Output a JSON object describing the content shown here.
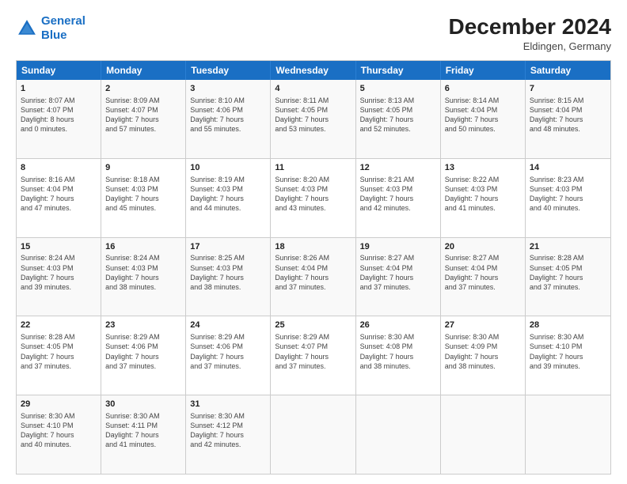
{
  "logo": {
    "line1": "General",
    "line2": "Blue"
  },
  "title": "December 2024",
  "location": "Eldingen, Germany",
  "days_of_week": [
    "Sunday",
    "Monday",
    "Tuesday",
    "Wednesday",
    "Thursday",
    "Friday",
    "Saturday"
  ],
  "weeks": [
    [
      {
        "day": "1",
        "lines": [
          "Sunrise: 8:07 AM",
          "Sunset: 4:07 PM",
          "Daylight: 8 hours",
          "and 0 minutes."
        ]
      },
      {
        "day": "2",
        "lines": [
          "Sunrise: 8:09 AM",
          "Sunset: 4:07 PM",
          "Daylight: 7 hours",
          "and 57 minutes."
        ]
      },
      {
        "day": "3",
        "lines": [
          "Sunrise: 8:10 AM",
          "Sunset: 4:06 PM",
          "Daylight: 7 hours",
          "and 55 minutes."
        ]
      },
      {
        "day": "4",
        "lines": [
          "Sunrise: 8:11 AM",
          "Sunset: 4:05 PM",
          "Daylight: 7 hours",
          "and 53 minutes."
        ]
      },
      {
        "day": "5",
        "lines": [
          "Sunrise: 8:13 AM",
          "Sunset: 4:05 PM",
          "Daylight: 7 hours",
          "and 52 minutes."
        ]
      },
      {
        "day": "6",
        "lines": [
          "Sunrise: 8:14 AM",
          "Sunset: 4:04 PM",
          "Daylight: 7 hours",
          "and 50 minutes."
        ]
      },
      {
        "day": "7",
        "lines": [
          "Sunrise: 8:15 AM",
          "Sunset: 4:04 PM",
          "Daylight: 7 hours",
          "and 48 minutes."
        ]
      }
    ],
    [
      {
        "day": "8",
        "lines": [
          "Sunrise: 8:16 AM",
          "Sunset: 4:04 PM",
          "Daylight: 7 hours",
          "and 47 minutes."
        ]
      },
      {
        "day": "9",
        "lines": [
          "Sunrise: 8:18 AM",
          "Sunset: 4:03 PM",
          "Daylight: 7 hours",
          "and 45 minutes."
        ]
      },
      {
        "day": "10",
        "lines": [
          "Sunrise: 8:19 AM",
          "Sunset: 4:03 PM",
          "Daylight: 7 hours",
          "and 44 minutes."
        ]
      },
      {
        "day": "11",
        "lines": [
          "Sunrise: 8:20 AM",
          "Sunset: 4:03 PM",
          "Daylight: 7 hours",
          "and 43 minutes."
        ]
      },
      {
        "day": "12",
        "lines": [
          "Sunrise: 8:21 AM",
          "Sunset: 4:03 PM",
          "Daylight: 7 hours",
          "and 42 minutes."
        ]
      },
      {
        "day": "13",
        "lines": [
          "Sunrise: 8:22 AM",
          "Sunset: 4:03 PM",
          "Daylight: 7 hours",
          "and 41 minutes."
        ]
      },
      {
        "day": "14",
        "lines": [
          "Sunrise: 8:23 AM",
          "Sunset: 4:03 PM",
          "Daylight: 7 hours",
          "and 40 minutes."
        ]
      }
    ],
    [
      {
        "day": "15",
        "lines": [
          "Sunrise: 8:24 AM",
          "Sunset: 4:03 PM",
          "Daylight: 7 hours",
          "and 39 minutes."
        ]
      },
      {
        "day": "16",
        "lines": [
          "Sunrise: 8:24 AM",
          "Sunset: 4:03 PM",
          "Daylight: 7 hours",
          "and 38 minutes."
        ]
      },
      {
        "day": "17",
        "lines": [
          "Sunrise: 8:25 AM",
          "Sunset: 4:03 PM",
          "Daylight: 7 hours",
          "and 38 minutes."
        ]
      },
      {
        "day": "18",
        "lines": [
          "Sunrise: 8:26 AM",
          "Sunset: 4:04 PM",
          "Daylight: 7 hours",
          "and 37 minutes."
        ]
      },
      {
        "day": "19",
        "lines": [
          "Sunrise: 8:27 AM",
          "Sunset: 4:04 PM",
          "Daylight: 7 hours",
          "and 37 minutes."
        ]
      },
      {
        "day": "20",
        "lines": [
          "Sunrise: 8:27 AM",
          "Sunset: 4:04 PM",
          "Daylight: 7 hours",
          "and 37 minutes."
        ]
      },
      {
        "day": "21",
        "lines": [
          "Sunrise: 8:28 AM",
          "Sunset: 4:05 PM",
          "Daylight: 7 hours",
          "and 37 minutes."
        ]
      }
    ],
    [
      {
        "day": "22",
        "lines": [
          "Sunrise: 8:28 AM",
          "Sunset: 4:05 PM",
          "Daylight: 7 hours",
          "and 37 minutes."
        ]
      },
      {
        "day": "23",
        "lines": [
          "Sunrise: 8:29 AM",
          "Sunset: 4:06 PM",
          "Daylight: 7 hours",
          "and 37 minutes."
        ]
      },
      {
        "day": "24",
        "lines": [
          "Sunrise: 8:29 AM",
          "Sunset: 4:06 PM",
          "Daylight: 7 hours",
          "and 37 minutes."
        ]
      },
      {
        "day": "25",
        "lines": [
          "Sunrise: 8:29 AM",
          "Sunset: 4:07 PM",
          "Daylight: 7 hours",
          "and 37 minutes."
        ]
      },
      {
        "day": "26",
        "lines": [
          "Sunrise: 8:30 AM",
          "Sunset: 4:08 PM",
          "Daylight: 7 hours",
          "and 38 minutes."
        ]
      },
      {
        "day": "27",
        "lines": [
          "Sunrise: 8:30 AM",
          "Sunset: 4:09 PM",
          "Daylight: 7 hours",
          "and 38 minutes."
        ]
      },
      {
        "day": "28",
        "lines": [
          "Sunrise: 8:30 AM",
          "Sunset: 4:10 PM",
          "Daylight: 7 hours",
          "and 39 minutes."
        ]
      }
    ],
    [
      {
        "day": "29",
        "lines": [
          "Sunrise: 8:30 AM",
          "Sunset: 4:10 PM",
          "Daylight: 7 hours",
          "and 40 minutes."
        ]
      },
      {
        "day": "30",
        "lines": [
          "Sunrise: 8:30 AM",
          "Sunset: 4:11 PM",
          "Daylight: 7 hours",
          "and 41 minutes."
        ]
      },
      {
        "day": "31",
        "lines": [
          "Sunrise: 8:30 AM",
          "Sunset: 4:12 PM",
          "Daylight: 7 hours",
          "and 42 minutes."
        ]
      },
      {
        "day": "",
        "lines": []
      },
      {
        "day": "",
        "lines": []
      },
      {
        "day": "",
        "lines": []
      },
      {
        "day": "",
        "lines": []
      }
    ]
  ]
}
